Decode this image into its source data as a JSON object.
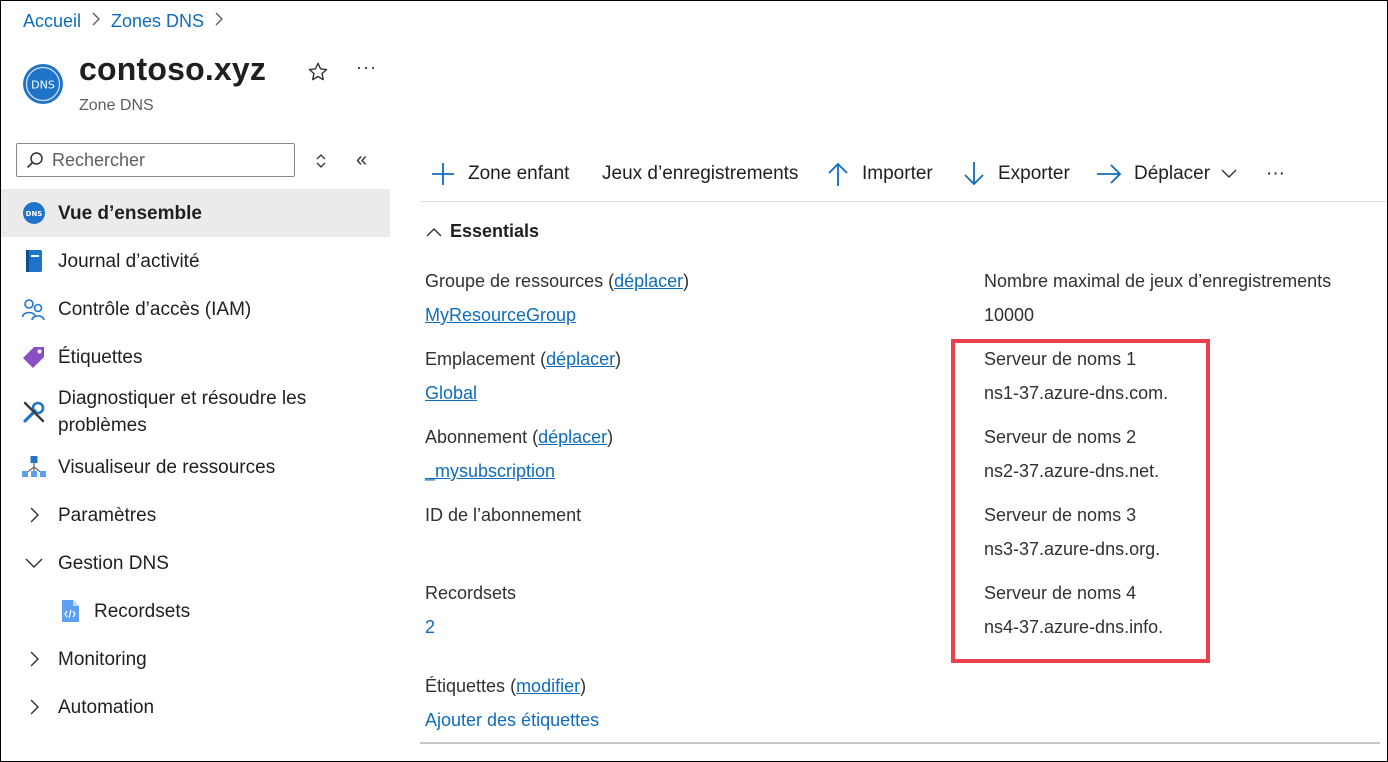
{
  "breadcrumb": {
    "items": [
      "Accueil",
      "Zones DNS"
    ]
  },
  "header": {
    "icon_text": "DNS",
    "title": "contoso.xyz",
    "subtitle": "Zone DNS"
  },
  "search": {
    "placeholder": "Rechercher"
  },
  "nav": {
    "items": [
      {
        "label": "Vue d’ensemble",
        "icon": "dns-icon",
        "active": true
      },
      {
        "label": "Journal d’activité",
        "icon": "book-icon"
      },
      {
        "label": "Contrôle d’accès (IAM)",
        "icon": "users-icon"
      },
      {
        "label": "Étiquettes",
        "icon": "tag-icon"
      },
      {
        "label": "Diagnostiquer et résoudre les problèmes",
        "icon": "wrench-icon"
      },
      {
        "label": "Visualiseur de ressources",
        "icon": "network-icon"
      },
      {
        "label": "Paramètres",
        "icon": "chevron-right-icon"
      },
      {
        "label": "Gestion DNS",
        "icon": "chevron-down-icon"
      },
      {
        "label": "Recordsets",
        "icon": "recordsets-icon"
      },
      {
        "label": "Monitoring",
        "icon": "chevron-right-icon"
      },
      {
        "label": "Automation",
        "icon": "chevron-right-icon"
      }
    ]
  },
  "toolbar": {
    "child_zone": "Zone enfant",
    "record_sets": "Jeux d’enregistrements",
    "import": "Importer",
    "export": "Exporter",
    "move": "Déplacer"
  },
  "essentials": {
    "title": "Essentials",
    "resource_group": {
      "label": "Groupe de ressources",
      "action": "déplacer",
      "value": "MyResourceGroup"
    },
    "location": {
      "label": "Emplacement",
      "action": "déplacer",
      "value": "Global"
    },
    "subscription": {
      "label": "Abonnement",
      "action": "déplacer",
      "value": "_mysubscription"
    },
    "subscription_id": {
      "label": "ID de l’abonnement"
    },
    "recordsets": {
      "label": "Recordsets",
      "value": "2"
    },
    "tags": {
      "label": "Étiquettes",
      "action": "modifier",
      "value": "Ajouter des étiquettes"
    },
    "max_record_sets": {
      "label": "Nombre maximal de jeux d’enregistrements",
      "value": "10000"
    },
    "name_servers": [
      {
        "label": "Serveur de noms 1",
        "value": "ns1-37.azure-dns.com."
      },
      {
        "label": "Serveur de noms 2",
        "value": "ns2-37.azure-dns.net."
      },
      {
        "label": "Serveur de noms 3",
        "value": "ns3-37.azure-dns.org."
      },
      {
        "label": "Serveur de noms 4",
        "value": "ns4-37.azure-dns.info."
      }
    ]
  },
  "colors": {
    "link": "#0f6cbd",
    "highlight": "#e8414b",
    "active_bg": "#edebe9"
  }
}
